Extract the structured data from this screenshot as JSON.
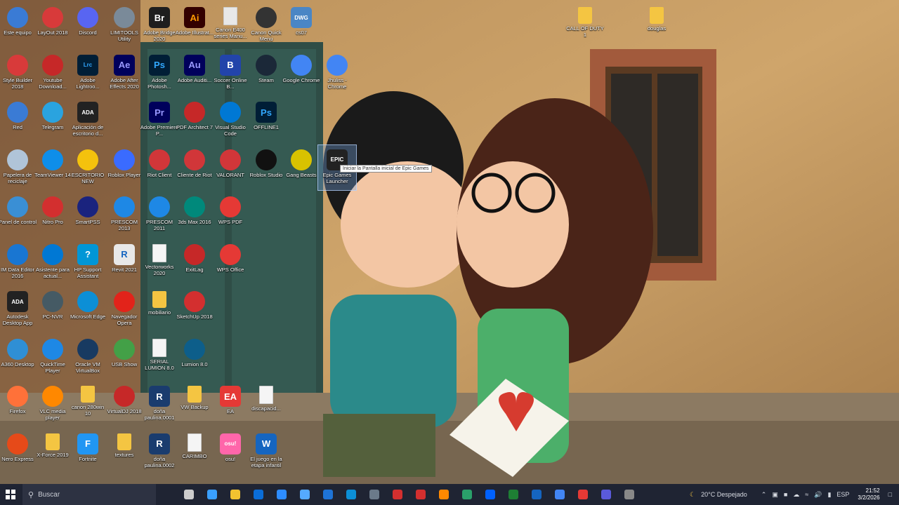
{
  "desktop": {
    "icons": [
      {
        "label": "Este equipo",
        "icon": "computer-icon",
        "color": "#3a7bd5"
      },
      {
        "label": "LayOut 2018",
        "icon": "layout-icon",
        "color": "#d83a3a"
      },
      {
        "label": "Discord",
        "icon": "discord-icon",
        "color": "#5865f2"
      },
      {
        "label": "LIMITOOLS Utility",
        "icon": "tools-icon",
        "color": "#7a8a99"
      },
      {
        "label": "Adobe Bridge 2020",
        "icon": "bridge-icon",
        "color": "#1e1e1e",
        "glyph": "Br"
      },
      {
        "label": "Adobe Illustrat...",
        "icon": "illustrator-icon",
        "color": "#330000",
        "glyph": "Ai",
        "fg": "#ff9a00"
      },
      {
        "label": "Canon E400 series Manu...",
        "icon": "document-icon",
        "color": "#e8e8e8"
      },
      {
        "label": "Canon Quick Menu",
        "icon": "canon-icon",
        "color": "#333"
      },
      {
        "label": "cs07",
        "icon": "dwg-icon",
        "color": "#4a86c5",
        "glyph": "DWG"
      },
      {
        "label": "Style Builder 2018",
        "icon": "stylebuilder-icon",
        "color": "#d83a3a"
      },
      {
        "label": "Youtube Download...",
        "icon": "youtube-download-icon",
        "color": "#c62828"
      },
      {
        "label": "Adobe Lightroo...",
        "icon": "lightroom-icon",
        "color": "#001e36",
        "glyph": "Lrc",
        "fg": "#31a8ff"
      },
      {
        "label": "Adobe After Effects 2020",
        "icon": "after-effects-icon",
        "color": "#00005b",
        "glyph": "Ae",
        "fg": "#9999ff"
      },
      {
        "label": "Adobe Photosh...",
        "icon": "photoshop-icon",
        "color": "#001e36",
        "glyph": "Ps",
        "fg": "#31a8ff"
      },
      {
        "label": "Adobe Auditi...",
        "icon": "audition-icon",
        "color": "#00005b",
        "glyph": "Au",
        "fg": "#9999ff"
      },
      {
        "label": "Soccer Online B...",
        "icon": "soccer-icon",
        "color": "#2244aa",
        "glyph": "B"
      },
      {
        "label": "Steam",
        "icon": "steam-icon",
        "color": "#1b2838"
      },
      {
        "label": "Google Chrome",
        "icon": "chrome-icon",
        "color": "#4285f4"
      },
      {
        "label": "Jhuliss - Chrome",
        "icon": "chrome-profile-icon",
        "color": "#4285f4"
      },
      {
        "label": "Red",
        "icon": "network-icon",
        "color": "#3a7bd5"
      },
      {
        "label": "Telegram",
        "icon": "telegram-icon",
        "color": "#2aa3df"
      },
      {
        "label": "Aplicación de escritorio d...",
        "icon": "autodesk-icon",
        "color": "#222",
        "glyph": "ADA"
      },
      {
        "label": "Adobe Premiere P...",
        "icon": "premiere-icon",
        "color": "#00005b",
        "glyph": "Pr",
        "fg": "#9999ff"
      },
      {
        "label": "PDF Architect 7",
        "icon": "pdf-architect-icon",
        "color": "#c62828"
      },
      {
        "label": "Visual Studio Code",
        "icon": "vscode-icon",
        "color": "#0078d4"
      },
      {
        "label": "OFFLINE1",
        "icon": "psd-file-icon",
        "color": "#001e36",
        "glyph": "Ps",
        "fg": "#31a8ff"
      },
      {
        "label": "Papelera de reciclaje",
        "icon": "recycle-bin-icon",
        "color": "#b0c4d8"
      },
      {
        "label": "TeamViewer 14",
        "icon": "teamviewer-icon",
        "color": "#0e8ee9"
      },
      {
        "label": "ESCRITORIO NEW",
        "icon": "warning-icon",
        "color": "#f4c20d"
      },
      {
        "label": "Roblox Player",
        "icon": "roblox-player-icon",
        "color": "#3a6bff"
      },
      {
        "label": "Riot Client",
        "icon": "riot-icon",
        "color": "#d13639"
      },
      {
        "label": "Cliente de Riot",
        "icon": "riot-icon",
        "color": "#d13639"
      },
      {
        "label": "VALORANT",
        "icon": "valorant-icon",
        "color": "#d13639"
      },
      {
        "label": "Roblox Studio",
        "icon": "roblox-studio-icon",
        "color": "#111"
      },
      {
        "label": "Gang Beasts",
        "icon": "gang-beasts-icon",
        "color": "#d8c200"
      },
      {
        "label": "Epic Games Launcher",
        "icon": "epic-games-icon",
        "color": "#222",
        "glyph": "EPIC"
      },
      {
        "label": "Panel de control",
        "icon": "control-panel-icon",
        "color": "#3a8fd5"
      },
      {
        "label": "Nitro Pro",
        "icon": "nitro-icon",
        "color": "#d32f2f"
      },
      {
        "label": "SmartPSS",
        "icon": "smartpss-icon",
        "color": "#1a237e"
      },
      {
        "label": "PRESCOM 2013",
        "icon": "prescom-icon",
        "color": "#1e88e5"
      },
      {
        "label": "PRESCOM 2011",
        "icon": "prescom-icon",
        "color": "#1e88e5"
      },
      {
        "label": "3ds Max 2016",
        "icon": "3dsmax-icon",
        "color": "#00897b"
      },
      {
        "label": "WPS PDF",
        "icon": "wps-pdf-icon",
        "color": "#e53935"
      },
      {
        "label": "IM Data Editor 2016",
        "icon": "data-editor-icon",
        "color": "#1976d2"
      },
      {
        "label": "Asistente para actual...",
        "icon": "windows-update-icon",
        "color": "#0078d4"
      },
      {
        "label": "HP Support Assistant",
        "icon": "help-icon",
        "color": "#0096d6",
        "glyph": "?"
      },
      {
        "label": "Revit 2021",
        "icon": "revit-icon",
        "color": "#e8e8e8",
        "glyph": "R",
        "fg": "#1565c0"
      },
      {
        "label": "Vectorworks 2020",
        "icon": "document-icon",
        "color": "#f5f5f5"
      },
      {
        "label": "ExitLag",
        "icon": "exitlag-icon",
        "color": "#c62828"
      },
      {
        "label": "WPS Office",
        "icon": "wps-office-icon",
        "color": "#e53935"
      },
      {
        "label": "Autodesk Desktop App",
        "icon": "autodesk-icon",
        "color": "#222",
        "glyph": "ADA"
      },
      {
        "label": "PC-NVR",
        "icon": "nvr-icon",
        "color": "#455a64"
      },
      {
        "label": "Microsoft Edge",
        "icon": "edge-icon",
        "color": "#0c8fd6"
      },
      {
        "label": "Navegador Opera",
        "icon": "opera-icon",
        "color": "#e2231a"
      },
      {
        "label": "mobiliario",
        "icon": "folder-icon",
        "color": "#f4c542"
      },
      {
        "label": "SketchUp 2018",
        "icon": "sketchup-icon",
        "color": "#d32f2f"
      },
      {
        "label": "A360 Desktop",
        "icon": "a360-icon",
        "color": "#2f8fd5"
      },
      {
        "label": "QuickTime Player",
        "icon": "quicktime-icon",
        "color": "#1e88e5"
      },
      {
        "label": "Oracle VM VirtualBox",
        "icon": "virtualbox-icon",
        "color": "#183a61"
      },
      {
        "label": "USB Show",
        "icon": "usb-show-icon",
        "color": "#43a047"
      },
      {
        "label": "SERIAL LUMION 8.0",
        "icon": "document-icon",
        "color": "#f5f5f5"
      },
      {
        "label": "Lumion 8.0",
        "icon": "lumion-icon",
        "color": "#0d5e8a"
      },
      {
        "label": "Firefox",
        "icon": "firefox-icon",
        "color": "#ff7139"
      },
      {
        "label": "VLC media player",
        "icon": "vlc-icon",
        "color": "#ff8800"
      },
      {
        "label": "canon 280win 10",
        "icon": "folder-icon",
        "color": "#f4c542"
      },
      {
        "label": "VirtualDJ 2018",
        "icon": "virtualdj-icon",
        "color": "#c62828"
      },
      {
        "label": "doña paulina.0001",
        "icon": "rvt-file-icon",
        "color": "#1a3c6e",
        "glyph": "R"
      },
      {
        "label": "VW Backup",
        "icon": "folder-icon",
        "color": "#f4c542"
      },
      {
        "label": "EA",
        "icon": "ea-icon",
        "color": "#e53935",
        "glyph": "EA"
      },
      {
        "label": "discapacid...",
        "icon": "word-document-icon",
        "color": "#f5f5f5"
      },
      {
        "label": "Nero Express",
        "icon": "nero-icon",
        "color": "#e64a19"
      },
      {
        "label": "X-Force 2019",
        "icon": "folder-icon",
        "color": "#f4c542"
      },
      {
        "label": "Fortnite",
        "icon": "fortnite-icon",
        "color": "#2196f3",
        "glyph": "F"
      },
      {
        "label": "textures",
        "icon": "folder-icon",
        "color": "#f4c542"
      },
      {
        "label": "doña paulina.0002",
        "icon": "rvt-file-icon",
        "color": "#1a3c6e",
        "glyph": "R"
      },
      {
        "label": "CARIMBO",
        "icon": "document-icon",
        "color": "#f5f5f5"
      },
      {
        "label": "osu!",
        "icon": "osu-icon",
        "color": "#ff66aa",
        "glyph": "osu!"
      },
      {
        "label": "El juego en la etapa infantil",
        "icon": "word-icon",
        "color": "#1565c0",
        "glyph": "W"
      },
      {
        "label": "CALL OF DUTY 1",
        "icon": "folder-icon",
        "color": "#f4c542"
      },
      {
        "label": "douglas",
        "icon": "folder-icon",
        "color": "#f4c542"
      }
    ],
    "tooltip": "Iniciar la Pantalla inicial de Epic Games"
  },
  "taskbar": {
    "search_placeholder": "Buscar",
    "apps": [
      "task-view-icon",
      "copilot-icon",
      "file-explorer-icon",
      "store-icon",
      "zoom-icon",
      "infinity-icon",
      "mail-icon",
      "edge-icon",
      "calculator-icon",
      "acrobat-icon",
      "sketchup-icon",
      "vlc-icon",
      "photos-icon",
      "dropbox-icon",
      "excel-icon",
      "word-icon",
      "chrome-icon",
      "wps-icon",
      "chrome-profile-icon",
      "settings-icon"
    ],
    "weather": "20°C Despejado",
    "language": "ESP",
    "time": "21:52",
    "date": "3/2/2026"
  },
  "colors": {
    "taskbar": "#1f2433",
    "selection": "#78aae6"
  }
}
